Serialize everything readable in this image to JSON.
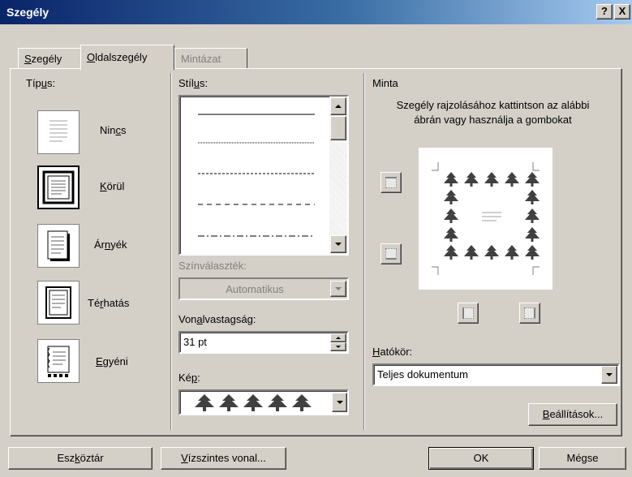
{
  "dialog": {
    "title": "Szegély",
    "help_btn": "?",
    "close_btn": "X"
  },
  "tabs": [
    {
      "pre": "",
      "key": "S",
      "post": "zegély",
      "state": "inactive"
    },
    {
      "pre": "",
      "key": "O",
      "post": "ldalszegély",
      "state": "active"
    },
    {
      "pre": "",
      "key": "",
      "post": "Mintázat",
      "state": "disabled"
    }
  ],
  "type_section": {
    "label_pre": "Típ",
    "label_key": "u",
    "label_post": "s:",
    "items": [
      {
        "pre": "Nin",
        "key": "c",
        "post": "s"
      },
      {
        "pre": "",
        "key": "K",
        "post": "örül"
      },
      {
        "pre": "Ár",
        "key": "n",
        "post": "yék"
      },
      {
        "pre": "Té",
        "key": "r",
        "post": "hatás"
      },
      {
        "pre": "",
        "key": "E",
        "post": "gyéni"
      }
    ]
  },
  "style_section": {
    "label_pre": "Stíl",
    "label_key": "u",
    "label_post": "s:",
    "color_label": "Színválaszték:",
    "color_value": "Automatikus",
    "width_label_pre": "Von",
    "width_label_key": "a",
    "width_label_post": "lvastagság:",
    "width_value": "31 pt",
    "art_label_pre": "Ké",
    "art_label_key": "p",
    "art_label_post": ":"
  },
  "preview_section": {
    "label": "Minta",
    "hint_line1": "Szegély rajzolásához kattintson az alábbi",
    "hint_line2": "ábrán vagy használja a gombokat",
    "apply_label_pre": "",
    "apply_label_key": "H",
    "apply_label_post": "atókör:",
    "apply_value": "Teljes dokumentum",
    "options_pre": "",
    "options_key": "B",
    "options_post": "eállítások..."
  },
  "footer": {
    "toolbar_pre": "Esz",
    "toolbar_key": "k",
    "toolbar_post": "öztár",
    "hline_pre": "",
    "hline_key": "V",
    "hline_post": "ízszintes vonal...",
    "ok_label": "OK",
    "cancel_label": "Mégse"
  },
  "colors": {
    "title_bg": "#0a246a",
    "face": "#d4d0c8",
    "art_fill": "#404040"
  }
}
